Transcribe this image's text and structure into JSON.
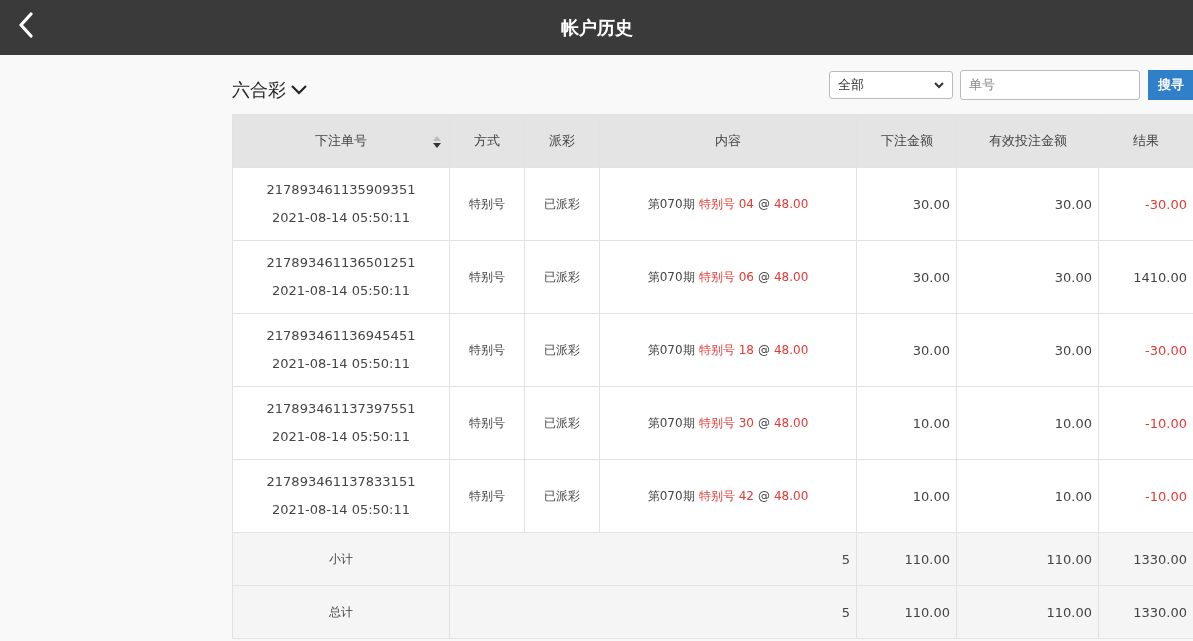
{
  "header": {
    "title": "帐户历史"
  },
  "toolbar": {
    "game": "六合彩",
    "filter": {
      "value": "全部"
    },
    "search": {
      "placeholder": "单号"
    },
    "search_button": "搜寻"
  },
  "table": {
    "columns": [
      {
        "label": "下注单号",
        "sortable": true
      },
      {
        "label": "方式",
        "sortable": false
      },
      {
        "label": "派彩",
        "sortable": false
      },
      {
        "label": "内容",
        "sortable": false
      },
      {
        "label": "下注金额",
        "sortable": false
      },
      {
        "label": "有效投注金额",
        "sortable": false
      },
      {
        "label": "结果",
        "sortable": false
      }
    ],
    "rows": [
      {
        "order_no": "217893461135909351",
        "time": "2021-08-14 05:50:11",
        "method": "特别号",
        "payout": "已派彩",
        "period": "第070期",
        "bet_type": "特别号",
        "number": "04",
        "at": "@",
        "odds": "48.00",
        "amount": "30.00",
        "valid_amount": "30.00",
        "result": "-30.00",
        "loss": true
      },
      {
        "order_no": "217893461136501251",
        "time": "2021-08-14 05:50:11",
        "method": "特别号",
        "payout": "已派彩",
        "period": "第070期",
        "bet_type": "特别号",
        "number": "06",
        "at": "@",
        "odds": "48.00",
        "amount": "30.00",
        "valid_amount": "30.00",
        "result": "1410.00",
        "loss": false
      },
      {
        "order_no": "217893461136945451",
        "time": "2021-08-14 05:50:11",
        "method": "特别号",
        "payout": "已派彩",
        "period": "第070期",
        "bet_type": "特别号",
        "number": "18",
        "at": "@",
        "odds": "48.00",
        "amount": "30.00",
        "valid_amount": "30.00",
        "result": "-30.00",
        "loss": true
      },
      {
        "order_no": "217893461137397551",
        "time": "2021-08-14 05:50:11",
        "method": "特别号",
        "payout": "已派彩",
        "period": "第070期",
        "bet_type": "特别号",
        "number": "30",
        "at": "@",
        "odds": "48.00",
        "amount": "10.00",
        "valid_amount": "10.00",
        "result": "-10.00",
        "loss": true
      },
      {
        "order_no": "217893461137833151",
        "time": "2021-08-14 05:50:11",
        "method": "特别号",
        "payout": "已派彩",
        "period": "第070期",
        "bet_type": "特别号",
        "number": "42",
        "at": "@",
        "odds": "48.00",
        "amount": "10.00",
        "valid_amount": "10.00",
        "result": "-10.00",
        "loss": true
      }
    ],
    "summary": [
      {
        "label": "小计",
        "count": "5",
        "amount": "110.00",
        "valid_amount": "110.00",
        "result": "1330.00"
      },
      {
        "label": "总计",
        "count": "5",
        "amount": "110.00",
        "valid_amount": "110.00",
        "result": "1330.00"
      }
    ]
  }
}
